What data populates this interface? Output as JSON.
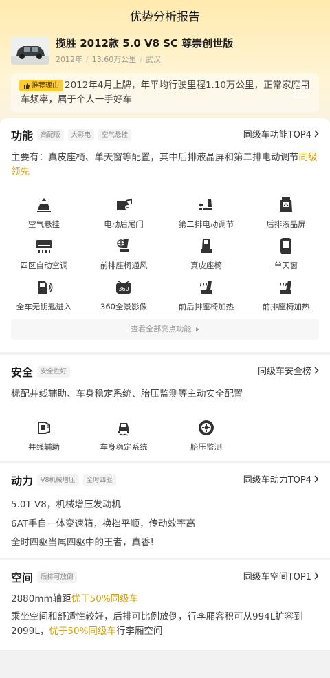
{
  "page": {
    "title": "优势分析报告"
  },
  "car": {
    "name": "揽胜 2012款 5.0 V8 SC 尊崇创世版",
    "year": "2012年",
    "mileage": "13.60万公里",
    "city": "武汉"
  },
  "reason": {
    "tag": "推荐理由",
    "text": "2012年4月上牌，年平均行驶里程1.10万公里，正常家庭用车频率，属于个人一手好车"
  },
  "features": {
    "title": "功能",
    "tags": [
      "高配版",
      "大彩电",
      "空气悬挂"
    ],
    "link": "同级车功能TOP4",
    "desc_main": "主要有：真皮座椅、单天窗等配置，其中后排液晶屏和第二排电动调节",
    "desc_hl": "同级领先",
    "items": [
      {
        "label": "空气悬挂",
        "icon": "air-suspension-icon"
      },
      {
        "label": "电动后尾门",
        "icon": "power-tailgate-icon"
      },
      {
        "label": "第二排电动调节",
        "icon": "second-row-seat-adjust-icon"
      },
      {
        "label": "后排液晶屏",
        "icon": "rear-screen-icon"
      },
      {
        "label": "四区自动空调",
        "icon": "climate-control-icon"
      },
      {
        "label": "前排座椅通风",
        "icon": "seat-ventilation-icon"
      },
      {
        "label": "真皮座椅",
        "icon": "leather-seat-icon"
      },
      {
        "label": "单天窗",
        "icon": "sunroof-icon"
      },
      {
        "label": "全车无钥匙进入",
        "icon": "keyless-entry-icon"
      },
      {
        "label": "360全景影像",
        "icon": "camera-360-icon"
      },
      {
        "label": "前后排座椅加热",
        "icon": "seat-heating-icon"
      },
      {
        "label": "前排座椅加热",
        "icon": "front-seat-heating-icon"
      }
    ],
    "more": "查看全部亮点功能"
  },
  "safety": {
    "title": "安全",
    "tags": [
      "安全性好"
    ],
    "link": "同级车安全榜",
    "desc": "标配并线辅助、车身稳定系统、胎压监测等主动安全配置",
    "items": [
      {
        "label": "并线辅助",
        "icon": "lane-assist-icon"
      },
      {
        "label": "车身稳定系统",
        "icon": "stability-control-icon"
      },
      {
        "label": "胎压监测",
        "icon": "tire-pressure-icon"
      }
    ]
  },
  "power": {
    "title": "动力",
    "tags": [
      "V8机械增压",
      "全时四驱"
    ],
    "link": "同级车动力TOP4",
    "lines": [
      "5.0T V8，机械增压发动机",
      "6AT手自一体变速箱，换挡平顺，传动效率高",
      "全时四驱当属四驱中的王者，真香!"
    ]
  },
  "space": {
    "title": "空间",
    "tags": [
      "后排可放倒"
    ],
    "link": "同级车空间TOP1",
    "line1_a": "2880mm轴距",
    "line1_hl": "优于50%同级车",
    "line2_a": "乘坐空间和舒适性较好，后排可比例放倒，行李厢容积可从994L扩容到2099L，",
    "line2_hl": "优于50%同级车",
    "line2_b": "行李厢空间"
  },
  "colors": {
    "accent": "#d4a010",
    "tag_bg": "#ffcb2e",
    "hero": "#ffeab0"
  }
}
